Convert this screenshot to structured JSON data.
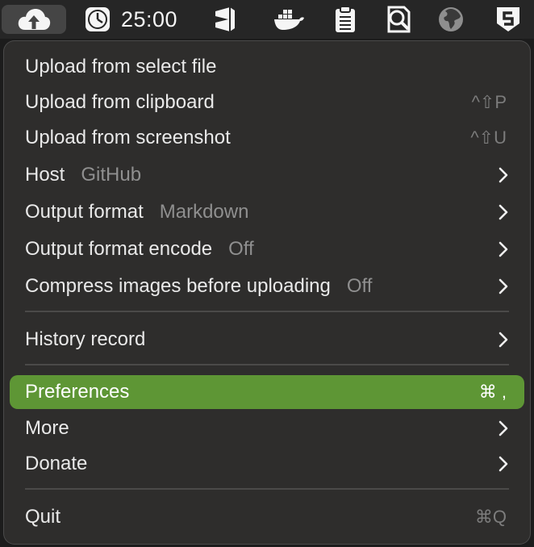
{
  "menubar": {
    "timer": "25:00",
    "icons": [
      "cloud-upload-icon",
      "clock-icon",
      "vscode-icon",
      "docker-icon",
      "clipboard-icon",
      "search-doc-icon",
      "globe-icon",
      "shield-s-icon"
    ]
  },
  "menu": {
    "items": [
      {
        "label": "Upload from select file",
        "value": "",
        "shortcut": ""
      },
      {
        "label": "Upload from clipboard",
        "value": "",
        "shortcut": "^⇧P"
      },
      {
        "label": "Upload from screenshot",
        "value": "",
        "shortcut": "^⇧U"
      },
      {
        "label": "Host",
        "value": "GitHub",
        "shortcut": ""
      },
      {
        "label": "Output format",
        "value": "Markdown",
        "shortcut": ""
      },
      {
        "label": "Output format encode",
        "value": "Off",
        "shortcut": ""
      },
      {
        "label": "Compress images before uploading",
        "value": "Off",
        "shortcut": ""
      },
      {
        "label": "History record",
        "value": "",
        "shortcut": ""
      },
      {
        "label": "Preferences",
        "value": "",
        "shortcut": "⌘ ,"
      },
      {
        "label": "More",
        "value": "",
        "shortcut": ""
      },
      {
        "label": "Donate",
        "value": "",
        "shortcut": ""
      },
      {
        "label": "Quit",
        "value": "",
        "shortcut": "⌘Q"
      }
    ]
  },
  "colors": {
    "highlight": "#5e9635",
    "menu_bg": "#2e2d2c",
    "text": "#e9e9e9",
    "secondary_text": "#8f8f8f"
  }
}
